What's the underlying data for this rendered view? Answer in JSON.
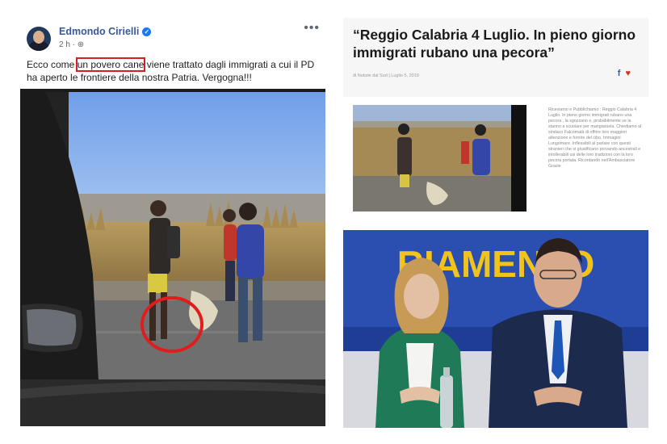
{
  "post": {
    "author": "Edmondo Cirielli",
    "verified_icon": "verified-badge-icon",
    "time": "2 h",
    "privacy_icon": "globe-icon",
    "more_icon": "ellipsis-icon",
    "more_label": "•••",
    "text_before": "Ecco come ",
    "text_highlight": "un povero cane",
    "text_after": " viene trattato dagli immigrati a cui il PD ha aperto le frontiere della nostra Patria. Vergogna!!!",
    "highlight_color": "#d42020",
    "link_color": "#385898"
  },
  "article": {
    "title": "“Reggio Calabria 4 Luglio. In pieno giorno immigrati rubano una pecora”",
    "meta": "di Notizie dal Sud  |  Luglio 5, 2019",
    "share_fb": "f",
    "share_tw": "♥",
    "blurb": "Riceviamo e Pubblichiamo : Reggio Calabria 4 Luglio. In pieno giorno immigrati rubano una pecora , la sgozzano e, probabilmente se la stanno a scuoiare per mangiarsela. Chiediamo al sindaco Falcomatà di offrire loro maggiori attenzione e fornire del cibo. Immagini Lungomare. Inflessibili al parlare con questi stranieri che si giustificano provando ancestrali e intollerabili usi delle loro tradizioni con la loro pecora portata. Ricordando nell'Ambasciatore Grazie"
  },
  "photo3": {
    "banner_text": "RIAMENTO",
    "banner_color": "#f2c31b",
    "backdrop_color": "#1e3e96"
  }
}
